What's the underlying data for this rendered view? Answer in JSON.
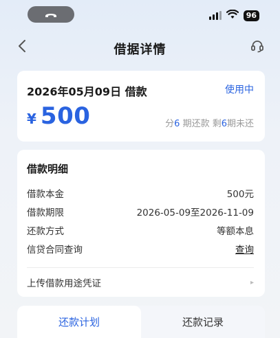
{
  "status_bar": {
    "battery": "96"
  },
  "nav": {
    "title": "借据详情"
  },
  "summary": {
    "loan_title": "2026年05月09日 借款",
    "status": "使用中",
    "currency": "¥",
    "amount": "500",
    "installments_prefix": "分",
    "total_periods": "6",
    "installments_mid": " 期还款 剩",
    "remaining_periods": "6",
    "installments_suffix": "期未还"
  },
  "detail": {
    "title": "借款明细",
    "rows": [
      {
        "label": "借款本金",
        "value": "500元"
      },
      {
        "label": "借款期限",
        "value": "2026-05-09至2026-11-09"
      },
      {
        "label": "还款方式",
        "value": "等额本息"
      },
      {
        "label": "信贷合同查询",
        "value": "查询"
      }
    ],
    "upload_label": "上传借款用途凭证",
    "upload_arrow": "▸"
  },
  "tabs": [
    {
      "label": "还款计划",
      "active": true
    },
    {
      "label": "还款记录",
      "active": false
    }
  ],
  "colors": {
    "accent": "#2a63e0",
    "background": "#eef2f8"
  },
  "icons": {
    "back": "chevron-left-icon",
    "service": "headset-icon",
    "call": "phone-icon",
    "signal": "signal-icon",
    "wifi": "wifi-icon"
  }
}
